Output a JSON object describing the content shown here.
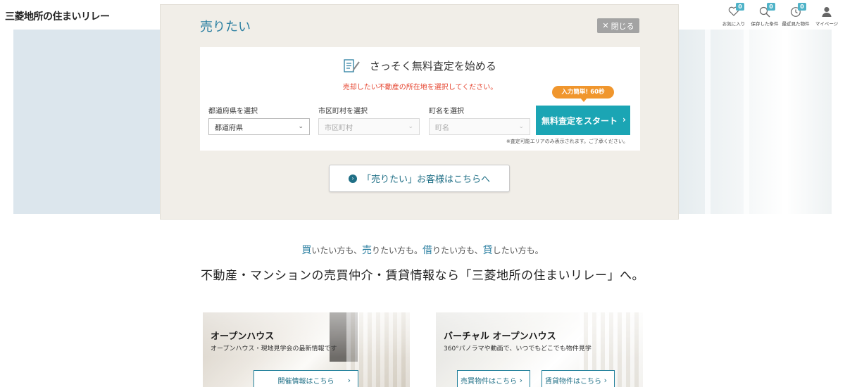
{
  "header": {
    "logo": "三菱地所の住まいリレー",
    "nav": [
      {
        "label": "お気に入り",
        "badge": "0",
        "icon": "heart-icon"
      },
      {
        "label": "保存した条件",
        "badge": "0",
        "icon": "search-icon"
      },
      {
        "label": "最近見た物件",
        "badge": "0",
        "icon": "history-icon"
      },
      {
        "label": "マイページ",
        "icon": "user-icon"
      }
    ]
  },
  "panel": {
    "title": "売りたい",
    "close_label": "閉じる",
    "form": {
      "heading": "さっそく無料査定を始める",
      "notice": "売却したい不動産の所在地を選択してください。",
      "prefecture": {
        "label": "都道府県を選択",
        "value": "都道府県"
      },
      "city": {
        "label": "市区町村を選択",
        "value": "市区町村"
      },
      "town": {
        "label": "町名を選択",
        "value": "町名"
      },
      "bubble": "入力簡単! 60秒",
      "start_label": "無料査定をスタート",
      "footnote": "※査定可能エリアのみ表示されます。ご了承ください。"
    },
    "cta_label": "「売りたい」お客様はこちらへ"
  },
  "tagline": {
    "line1": [
      {
        "hl": "買",
        "rest": "いたい方も、"
      },
      {
        "hl": "売",
        "rest": "りたい方も。"
      },
      {
        "hl": "借",
        "rest": "りたい方も、"
      },
      {
        "hl": "貸",
        "rest": "したい方も。"
      }
    ],
    "line2": "不動産・マンションの売買仲介・賃貸情報なら「三菱地所の住まいリレー」へ。"
  },
  "cards": [
    {
      "title": "オープンハウス",
      "subtitle": "オープンハウス・現地見学会の最新情報です",
      "buttons": [
        "開催情報はこちら"
      ]
    },
    {
      "title": "バーチャル オープンハウス",
      "subtitle": "360°パノラマや動画で、いつでもどこでも物件見学",
      "buttons": [
        "売買物件はこちら",
        "賃貸物件はこちら"
      ]
    }
  ],
  "colors": {
    "accent": "#1ba5b4",
    "brand_blue": "#2b7fa1",
    "notice_red": "#e5432e",
    "bubble_orange": "#f0962d",
    "badge": "#4fb3c8"
  }
}
